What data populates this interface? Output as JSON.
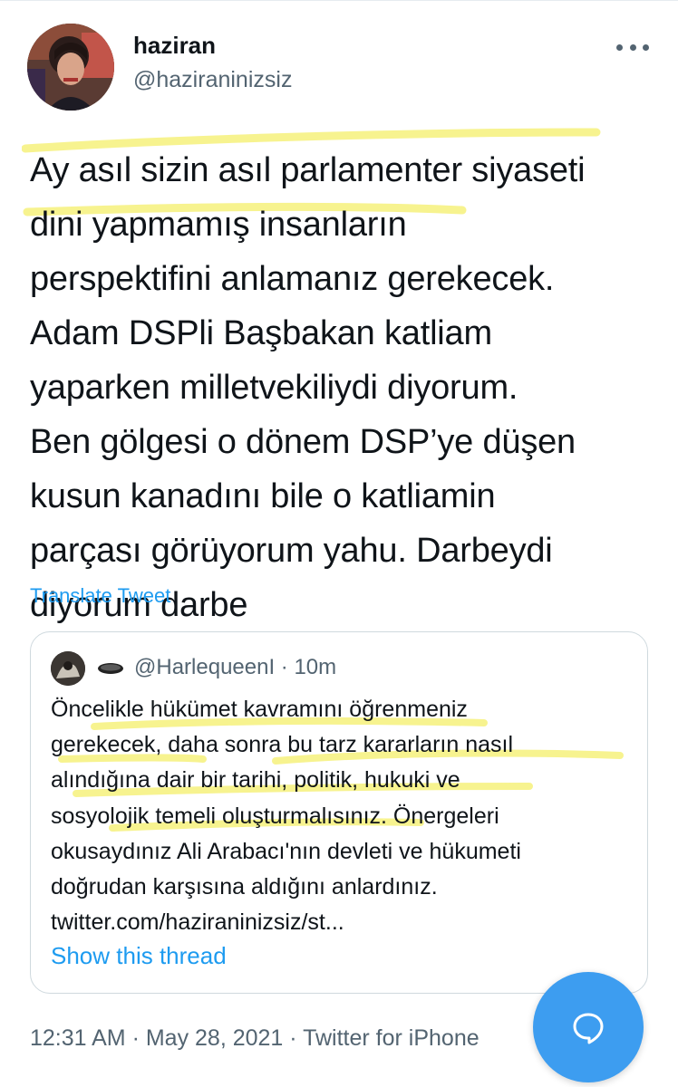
{
  "tweet": {
    "display_name": "haziran",
    "handle": "@haziraninizsiz",
    "text_lines": [
      "Ay asıl sizin asıl parlamenter siyaseti",
      "dini yapmamış insanların",
      "perspektifini anlamanız gerekecek.",
      "Adam DSPli Başbakan katliam",
      "yaparken milletvekiliydi diyorum.",
      "Ben gölgesi o dönem DSP’ye düşen",
      "kusun kanadını bile o katliamin",
      "parçası görüyorum yahu. Darbeydi",
      "diyorum darbe"
    ],
    "translate_label": "Translate Tweet",
    "footer": "12:31 AM · May 28, 2021 · Twitter for iPhone"
  },
  "quoted_tweet": {
    "meta": "@HarlequeenI · 10m",
    "text_lines": [
      "Öncelikle hükümet kavramını öğrenmeniz",
      "gerekecek, daha sonra bu tarz kararların nasıl",
      "alındığına dair bir tarihi, politik, hukuki ve",
      "sosyolojik temeli oluşturmalısınız. Önergeleri",
      "okusaydınız Ali Arabacı'nın devleti ve hükumeti",
      "doğrudan karşısına aldığını anlardınız.",
      "twitter.com/haziraninizsiz/st..."
    ],
    "show_thread_label": "Show this thread"
  },
  "colors": {
    "link": "#1d9bf0",
    "secondary_text": "#536471",
    "highlight": "#f7f38a",
    "fab": "#3d9df0"
  },
  "icons": {
    "more": "more-horizontal-icon",
    "compose": "chat-bubble-icon"
  }
}
